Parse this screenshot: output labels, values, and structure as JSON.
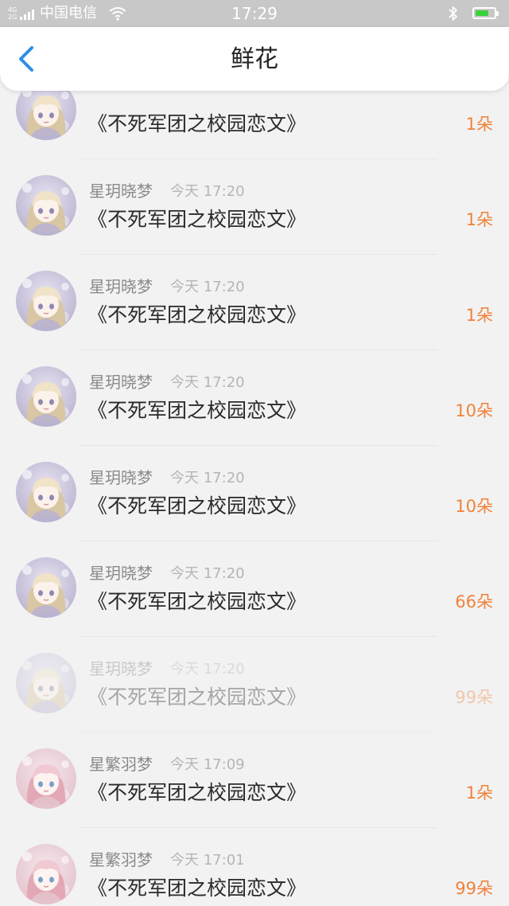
{
  "status_bar": {
    "net_top": "4G",
    "net_bottom": "2G",
    "carrier": "中国电信",
    "time": "17:29",
    "battery_color": "#3bd13b"
  },
  "header": {
    "back_icon": "chevron-left-icon",
    "back_color": "#2d8ee8",
    "title": "鲜花"
  },
  "rows": [
    {
      "name": "",
      "time": "",
      "book": "《不死军团之校园恋文》",
      "count": "1朵",
      "avatar_theme": "lavender"
    },
    {
      "name": "星玥晓梦",
      "time": "今天 17:20",
      "book": "《不死军团之校园恋文》",
      "count": "1朵",
      "avatar_theme": "lavender"
    },
    {
      "name": "星玥晓梦",
      "time": "今天 17:20",
      "book": "《不死军团之校园恋文》",
      "count": "1朵",
      "avatar_theme": "lavender"
    },
    {
      "name": "星玥晓梦",
      "time": "今天 17:20",
      "book": "《不死军团之校园恋文》",
      "count": "10朵",
      "avatar_theme": "lavender"
    },
    {
      "name": "星玥晓梦",
      "time": "今天 17:20",
      "book": "《不死军团之校园恋文》",
      "count": "10朵",
      "avatar_theme": "lavender"
    },
    {
      "name": "星玥晓梦",
      "time": "今天 17:20",
      "book": "《不死军团之校园恋文》",
      "count": "66朵",
      "avatar_theme": "lavender"
    },
    {
      "name": "星玥晓梦",
      "time": "今天 17:20",
      "book": "《不死军团之校园恋文》",
      "count": "99朵",
      "avatar_theme": "lavender",
      "faded": true
    },
    {
      "name": "星繁羽梦",
      "time": "今天 17:09",
      "book": "《不死军团之校园恋文》",
      "count": "1朵",
      "avatar_theme": "pink"
    },
    {
      "name": "星繁羽梦",
      "time": "今天 17:01",
      "book": "《不死军团之校园恋文》",
      "count": "99朵",
      "avatar_theme": "pink"
    }
  ],
  "colors": {
    "count": "#f0823a",
    "book": "#2a2a2a",
    "name": "#8a8a8a",
    "time": "#b5b5b5"
  }
}
